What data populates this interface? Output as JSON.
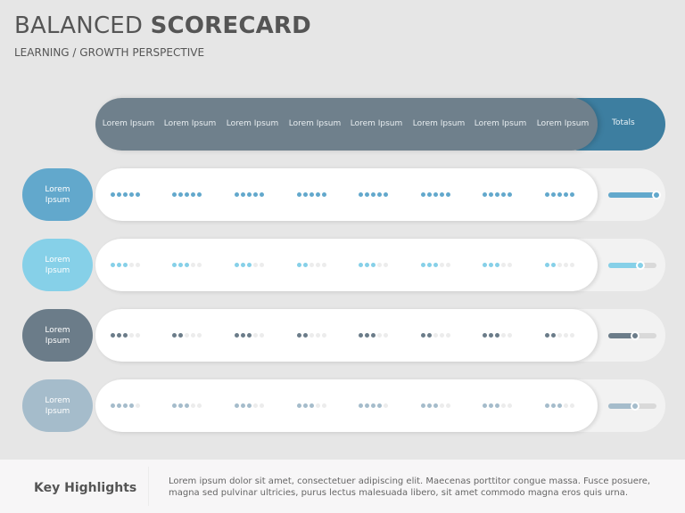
{
  "title": {
    "light": "BALANCED",
    "bold": "SCORECARD"
  },
  "subtitle": "LEARNING / GROWTH PERSPECTIVE",
  "header": {
    "columns": [
      "Lorem Ipsum",
      "Lorem Ipsum",
      "Lorem Ipsum",
      "Lorem Ipsum",
      "Lorem Ipsum",
      "Lorem Ipsum",
      "Lorem Ipsum",
      "Lorem Ipsum"
    ],
    "totals_label": "Totals",
    "bar_color": "#6f808c",
    "totals_color": "#3d7ea0"
  },
  "rows": [
    {
      "label": "Lorem Ipsum",
      "color": "#62a8cc",
      "scores": [
        5,
        5,
        5,
        5,
        5,
        5,
        5,
        5
      ],
      "max_score": 5,
      "total_fraction": 1.0
    },
    {
      "label": "Lorem Ipsum",
      "color": "#86d0e8",
      "scores": [
        3,
        3,
        3,
        2,
        3,
        3,
        3,
        2
      ],
      "max_score": 5,
      "total_fraction": 0.67
    },
    {
      "label": "Lorem Ipsum",
      "color": "#6b7c89",
      "scores": [
        3,
        2,
        3,
        2,
        3,
        2,
        3,
        2
      ],
      "max_score": 5,
      "total_fraction": 0.55
    },
    {
      "label": "Lorem Ipsum",
      "color": "#a5bccb",
      "scores": [
        4,
        3,
        3,
        3,
        4,
        3,
        3,
        3
      ],
      "max_score": 5,
      "total_fraction": 0.55
    }
  ],
  "empty_dot_color": "#ececec",
  "footer": {
    "title": "Key Highlights",
    "text": "Lorem ipsum dolor sit amet, consectetuer adipiscing elit. Maecenas porttitor congue massa. Fusce posuere, magna sed pulvinar ultricies, purus lectus malesuada libero, sit amet commodo magna eros quis urna."
  }
}
